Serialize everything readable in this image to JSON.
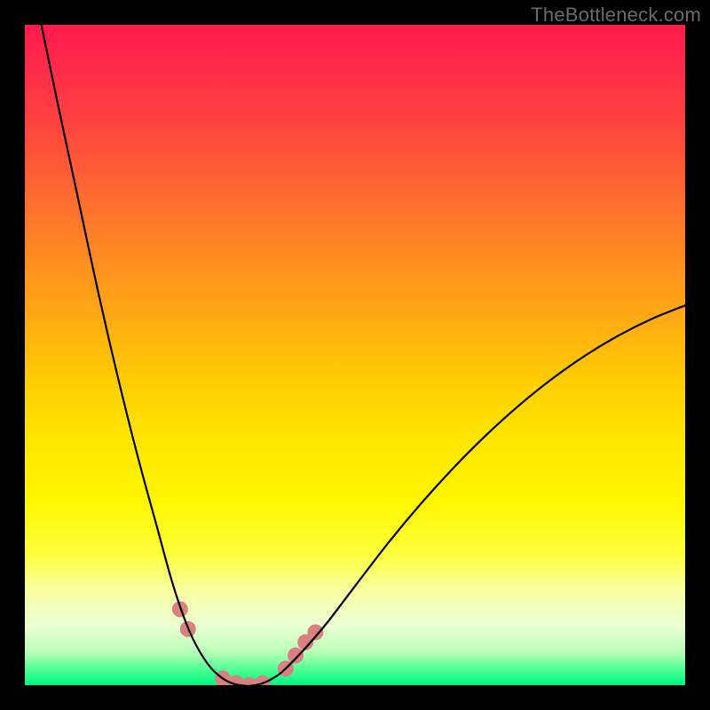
{
  "watermark": {
    "text": "TheBottleneck.com"
  },
  "chart_data": {
    "type": "line",
    "title": "",
    "xlabel": "",
    "ylabel": "",
    "xlim": [
      0,
      1
    ],
    "ylim": [
      0,
      1
    ],
    "grid": false,
    "legend": false,
    "annotations": [],
    "background_gradient": {
      "direction": "vertical",
      "stops": [
        {
          "pos": 0.0,
          "color": "#ff1a4d"
        },
        {
          "pos": 0.5,
          "color": "#ffd000"
        },
        {
          "pos": 0.8,
          "color": "#fcff60"
        },
        {
          "pos": 1.0,
          "color": "#00f584"
        }
      ]
    },
    "series": [
      {
        "name": "bottleneck-curve",
        "color": "#000000",
        "x": [
          0.025,
          0.05,
          0.08,
          0.11,
          0.14,
          0.17,
          0.2,
          0.225,
          0.25,
          0.275,
          0.3,
          0.325,
          0.35,
          0.375,
          0.4,
          0.45,
          0.5,
          0.55,
          0.6,
          0.65,
          0.7,
          0.75,
          0.8,
          0.85,
          0.9,
          0.95,
          1.0
        ],
        "y": [
          1.0,
          0.88,
          0.74,
          0.6,
          0.47,
          0.35,
          0.24,
          0.15,
          0.08,
          0.035,
          0.01,
          0.0,
          0.0,
          0.01,
          0.03,
          0.085,
          0.15,
          0.215,
          0.275,
          0.33,
          0.38,
          0.425,
          0.465,
          0.5,
          0.53,
          0.555,
          0.575
        ]
      }
    ],
    "markers": [
      {
        "name": "highlight-dots",
        "color": "#d98080",
        "radius_px": 9,
        "points": [
          {
            "x": 0.235,
            "y": 0.115
          },
          {
            "x": 0.247,
            "y": 0.085
          },
          {
            "x": 0.3,
            "y": 0.01
          },
          {
            "x": 0.32,
            "y": 0.003
          },
          {
            "x": 0.34,
            "y": 0.0
          },
          {
            "x": 0.36,
            "y": 0.003
          },
          {
            "x": 0.395,
            "y": 0.025
          },
          {
            "x": 0.41,
            "y": 0.045
          },
          {
            "x": 0.425,
            "y": 0.065
          },
          {
            "x": 0.44,
            "y": 0.08
          }
        ]
      }
    ]
  }
}
